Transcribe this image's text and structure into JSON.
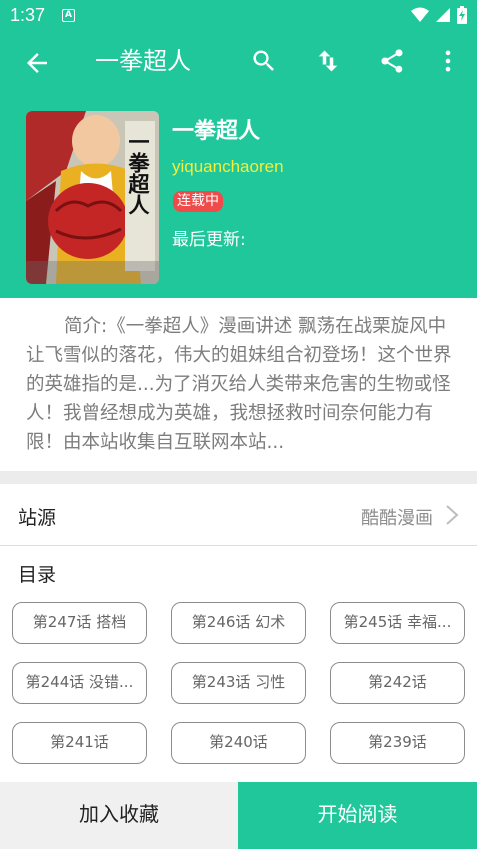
{
  "status_bar": {
    "time": "1:37",
    "notification_icon": "a-icon"
  },
  "toolbar": {
    "title": "一拳超人",
    "icons": [
      "back-arrow-icon",
      "search-icon",
      "sort-icon",
      "share-icon",
      "more-vert-icon"
    ]
  },
  "comic": {
    "title": "一拳超人",
    "author": "yiquanchaoren",
    "status_badge": "连载中",
    "last_update_label": "最后更新:",
    "cover_text": "一拳超人"
  },
  "intro": "简介:《一拳超人》漫画讲述 飘荡在战栗旋风中让飞雪似的落花，伟大的姐妹组合初登场！这个世界的英雄指的是...为了消灭给人类带来危害的生物或怪人！我曾经想成为英雄，我想拯救时间奈何能力有限！由本站收集自互联网本站...",
  "source": {
    "label": "站源",
    "value": "酷酷漫画"
  },
  "catalog": {
    "label": "目录",
    "chapters": [
      "第247话 搭档",
      "第246话 幻术",
      "第245话 幸福...",
      "第244话 没错...",
      "第243话 习性",
      "第242话",
      "第241话",
      "第240话",
      "第239话"
    ]
  },
  "actions": {
    "favorite": "加入收藏",
    "read": "开始阅读"
  },
  "colors": {
    "primary": "#1fc79a",
    "badge": "#ef4b4b",
    "author": "#f5ee3a"
  }
}
